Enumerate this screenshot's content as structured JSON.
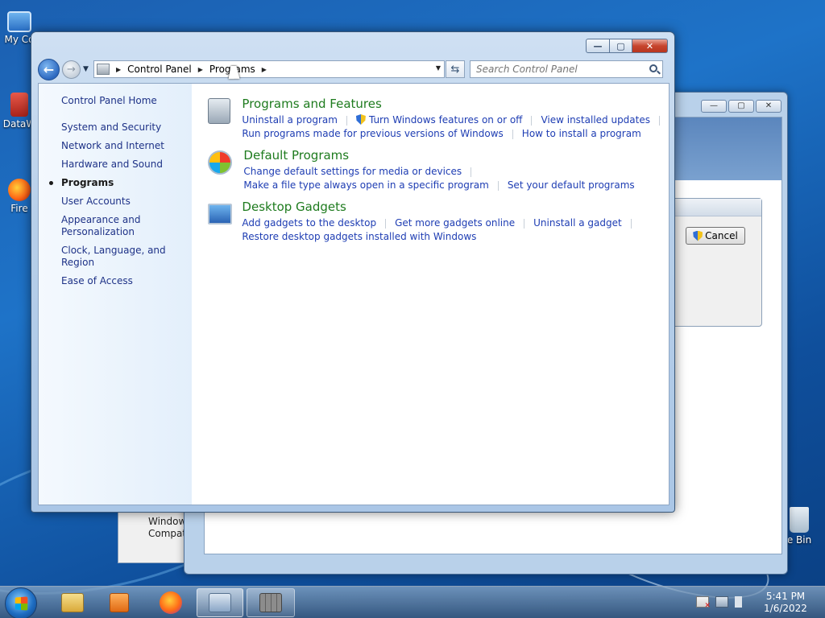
{
  "desktop": {
    "icons": [
      {
        "label": "My Co"
      },
      {
        "label": "DataW"
      },
      {
        "label": "Fire"
      },
      {
        "label": "e Bin"
      }
    ],
    "background_window": {
      "text_line1": "Window",
      "text_line2": "Compat"
    },
    "dialog": {
      "cancel_label": "Cancel"
    }
  },
  "window": {
    "breadcrumb": [
      "Control Panel",
      "Programs"
    ],
    "search_placeholder": "Search Control Panel",
    "caption_buttons": {
      "minimize": "—",
      "maximize": "▢",
      "close": "✕"
    }
  },
  "sidebar": {
    "home": "Control Panel Home",
    "items": [
      {
        "label": "System and Security"
      },
      {
        "label": "Network and Internet"
      },
      {
        "label": "Hardware and Sound"
      },
      {
        "label": "Programs"
      },
      {
        "label": "User Accounts"
      },
      {
        "label": "Appearance and Personalization"
      },
      {
        "label": "Clock, Language, and Region"
      },
      {
        "label": "Ease of Access"
      }
    ],
    "current": "Programs"
  },
  "categories": [
    {
      "title": "Programs and Features",
      "icon": "programs-icon",
      "rows": [
        [
          "Uninstall a program",
          "Turn Windows features on or off",
          "View installed updates"
        ],
        [
          "Run programs made for previous versions of Windows",
          "How to install a program"
        ]
      ]
    },
    {
      "title": "Default Programs",
      "icon": "default-programs-icon",
      "rows": [
        [
          "Change default settings for media or devices"
        ],
        [
          "Make a file type always open in a specific program",
          "Set your default programs"
        ]
      ]
    },
    {
      "title": "Desktop Gadgets",
      "icon": "gadgets-icon",
      "rows": [
        [
          "Add gadgets to the desktop",
          "Get more gadgets online",
          "Uninstall a gadget"
        ],
        [
          "Restore desktop gadgets installed with Windows"
        ]
      ]
    }
  ],
  "taskbar": {
    "time": "5:41 PM",
    "date": "1/6/2022"
  },
  "colors": {
    "link": "#1e3db3",
    "category_title": "#1e7b1e",
    "sidebar_link": "#1e3287"
  }
}
